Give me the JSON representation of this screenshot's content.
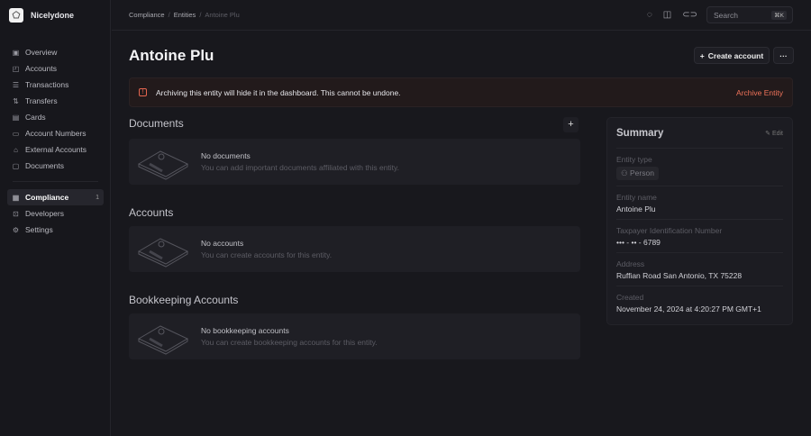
{
  "app": {
    "name": "Nicelydone"
  },
  "sidebar": {
    "items": [
      {
        "label": "Overview",
        "icon": "chart-icon"
      },
      {
        "label": "Accounts",
        "icon": "wallet-icon"
      },
      {
        "label": "Transactions",
        "icon": "transactions-icon"
      },
      {
        "label": "Transfers",
        "icon": "transfer-icon"
      },
      {
        "label": "Cards",
        "icon": "card-icon"
      },
      {
        "label": "Account Numbers",
        "icon": "number-icon"
      },
      {
        "label": "External Accounts",
        "icon": "bank-icon"
      },
      {
        "label": "Documents",
        "icon": "folder-icon"
      }
    ],
    "secondary": [
      {
        "label": "Compliance",
        "icon": "file-icon",
        "badge": "1"
      },
      {
        "label": "Developers",
        "icon": "terminal-icon"
      },
      {
        "label": "Settings",
        "icon": "gear-icon"
      }
    ]
  },
  "breadcrumb": [
    "Compliance",
    "Entities",
    "Antoine Plu"
  ],
  "search": {
    "placeholder": "Search",
    "shortcut": "⌘K"
  },
  "page": {
    "title": "Antoine Plu",
    "create_label": "Create account",
    "more_label": "···"
  },
  "banner": {
    "message": "Archiving this entity will hide it in the dashboard. This cannot be undone.",
    "action": "Archive Entity",
    "accent": "#f0735a"
  },
  "sections": [
    {
      "title": "Documents",
      "empty_title": "No documents",
      "empty_text": "You can add important documents affiliated with this entity."
    },
    {
      "title": "Accounts",
      "empty_title": "No accounts",
      "empty_text": "You can create accounts for this entity."
    },
    {
      "title": "Bookkeeping Accounts",
      "empty_title": "No bookkeeping accounts",
      "empty_text": "You can create bookkeeping accounts for this entity."
    }
  ],
  "summary": {
    "title": "Summary",
    "edit": "Edit",
    "fields": [
      {
        "label": "Entity type",
        "value": "Person"
      },
      {
        "label": "Entity name",
        "value": "Antoine Plu"
      },
      {
        "label": "Taxpayer Identification Number",
        "value": "••• - •• - 6789"
      },
      {
        "label": "Address",
        "value": "Ruffian Road San Antonio, TX 75228"
      },
      {
        "label": "Created",
        "value": "November 24, 2024 at 4:20:27 PM GMT+1"
      }
    ]
  }
}
